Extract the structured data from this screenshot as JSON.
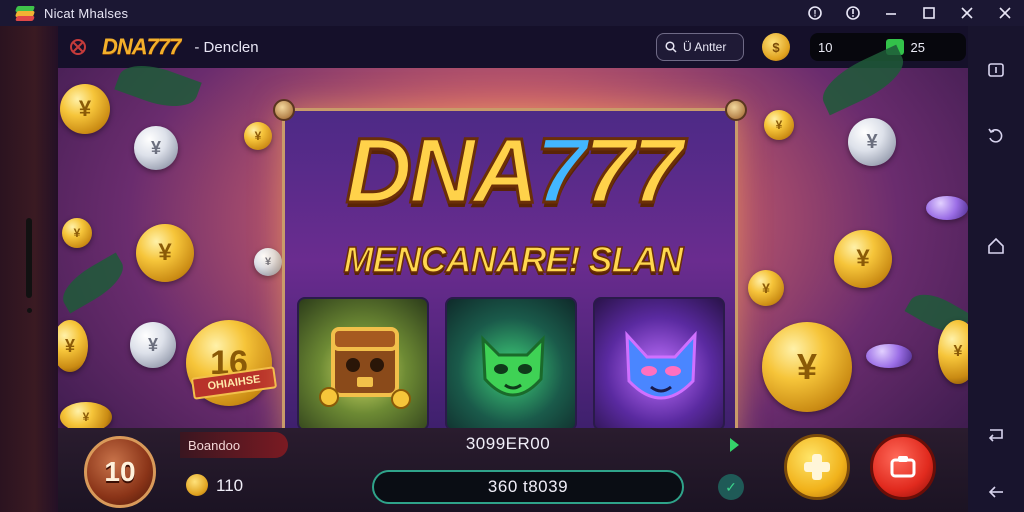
{
  "window": {
    "title": "Nicat Mhalses",
    "controls": [
      "help",
      "settings",
      "minimize",
      "maximize",
      "close"
    ]
  },
  "header": {
    "logo": "DNA777",
    "breadcrumb_sep": "-",
    "breadcrumb": "Denclen",
    "search_label": "Ü Antter",
    "level": "10",
    "gem_count": "25"
  },
  "banner": {
    "logo_gold": "DNA",
    "logo_blue": "7",
    "logo_gold2": "77",
    "subtitle": "MENCANARE! SLAN",
    "badge_text": "OHIAIHSE",
    "tiles": [
      "treasure-chest",
      "green-cat",
      "blue-cat"
    ]
  },
  "bottom": {
    "spin_count": "10",
    "bonus_label": "Boandoo",
    "balance_text": "3099ER00",
    "bet_value": "110",
    "wallet_value": "360 t8039"
  },
  "sidebar": {
    "icons": [
      "keymap-icon",
      "rotate-icon",
      "home-icon",
      "back-icon",
      "return-icon"
    ]
  },
  "colors": {
    "accent_gold": "#f3b02b",
    "accent_blue": "#43b7ff",
    "panel_purple": "#4d2a86",
    "wallet_border": "#2fa38a",
    "cam_red": "#e12a1e"
  }
}
